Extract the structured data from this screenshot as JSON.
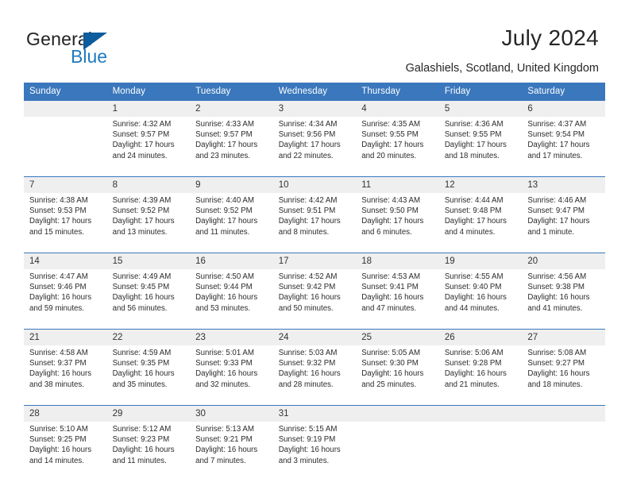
{
  "brand": {
    "word1": "General",
    "word2": "Blue",
    "triangle_color": "#0d5c9e",
    "blue_text_color": "#1f7ac0"
  },
  "header": {
    "title": "July 2024",
    "subtitle": "Galashiels, Scotland, United Kingdom",
    "header_bg_color": "#3a77bc",
    "daynum_bg_color": "#efefef"
  },
  "calendar": {
    "weekday_headers": [
      "Sunday",
      "Monday",
      "Tuesday",
      "Wednesday",
      "Thursday",
      "Friday",
      "Saturday"
    ],
    "weeks": [
      {
        "days": [
          {
            "date": "",
            "lines": []
          },
          {
            "date": "1",
            "lines": [
              "Sunrise: 4:32 AM",
              "Sunset: 9:57 PM",
              "Daylight: 17 hours",
              "and 24 minutes."
            ]
          },
          {
            "date": "2",
            "lines": [
              "Sunrise: 4:33 AM",
              "Sunset: 9:57 PM",
              "Daylight: 17 hours",
              "and 23 minutes."
            ]
          },
          {
            "date": "3",
            "lines": [
              "Sunrise: 4:34 AM",
              "Sunset: 9:56 PM",
              "Daylight: 17 hours",
              "and 22 minutes."
            ]
          },
          {
            "date": "4",
            "lines": [
              "Sunrise: 4:35 AM",
              "Sunset: 9:55 PM",
              "Daylight: 17 hours",
              "and 20 minutes."
            ]
          },
          {
            "date": "5",
            "lines": [
              "Sunrise: 4:36 AM",
              "Sunset: 9:55 PM",
              "Daylight: 17 hours",
              "and 18 minutes."
            ]
          },
          {
            "date": "6",
            "lines": [
              "Sunrise: 4:37 AM",
              "Sunset: 9:54 PM",
              "Daylight: 17 hours",
              "and 17 minutes."
            ]
          }
        ]
      },
      {
        "days": [
          {
            "date": "7",
            "lines": [
              "Sunrise: 4:38 AM",
              "Sunset: 9:53 PM",
              "Daylight: 17 hours",
              "and 15 minutes."
            ]
          },
          {
            "date": "8",
            "lines": [
              "Sunrise: 4:39 AM",
              "Sunset: 9:52 PM",
              "Daylight: 17 hours",
              "and 13 minutes."
            ]
          },
          {
            "date": "9",
            "lines": [
              "Sunrise: 4:40 AM",
              "Sunset: 9:52 PM",
              "Daylight: 17 hours",
              "and 11 minutes."
            ]
          },
          {
            "date": "10",
            "lines": [
              "Sunrise: 4:42 AM",
              "Sunset: 9:51 PM",
              "Daylight: 17 hours",
              "and 8 minutes."
            ]
          },
          {
            "date": "11",
            "lines": [
              "Sunrise: 4:43 AM",
              "Sunset: 9:50 PM",
              "Daylight: 17 hours",
              "and 6 minutes."
            ]
          },
          {
            "date": "12",
            "lines": [
              "Sunrise: 4:44 AM",
              "Sunset: 9:48 PM",
              "Daylight: 17 hours",
              "and 4 minutes."
            ]
          },
          {
            "date": "13",
            "lines": [
              "Sunrise: 4:46 AM",
              "Sunset: 9:47 PM",
              "Daylight: 17 hours",
              "and 1 minute."
            ]
          }
        ]
      },
      {
        "days": [
          {
            "date": "14",
            "lines": [
              "Sunrise: 4:47 AM",
              "Sunset: 9:46 PM",
              "Daylight: 16 hours",
              "and 59 minutes."
            ]
          },
          {
            "date": "15",
            "lines": [
              "Sunrise: 4:49 AM",
              "Sunset: 9:45 PM",
              "Daylight: 16 hours",
              "and 56 minutes."
            ]
          },
          {
            "date": "16",
            "lines": [
              "Sunrise: 4:50 AM",
              "Sunset: 9:44 PM",
              "Daylight: 16 hours",
              "and 53 minutes."
            ]
          },
          {
            "date": "17",
            "lines": [
              "Sunrise: 4:52 AM",
              "Sunset: 9:42 PM",
              "Daylight: 16 hours",
              "and 50 minutes."
            ]
          },
          {
            "date": "18",
            "lines": [
              "Sunrise: 4:53 AM",
              "Sunset: 9:41 PM",
              "Daylight: 16 hours",
              "and 47 minutes."
            ]
          },
          {
            "date": "19",
            "lines": [
              "Sunrise: 4:55 AM",
              "Sunset: 9:40 PM",
              "Daylight: 16 hours",
              "and 44 minutes."
            ]
          },
          {
            "date": "20",
            "lines": [
              "Sunrise: 4:56 AM",
              "Sunset: 9:38 PM",
              "Daylight: 16 hours",
              "and 41 minutes."
            ]
          }
        ]
      },
      {
        "days": [
          {
            "date": "21",
            "lines": [
              "Sunrise: 4:58 AM",
              "Sunset: 9:37 PM",
              "Daylight: 16 hours",
              "and 38 minutes."
            ]
          },
          {
            "date": "22",
            "lines": [
              "Sunrise: 4:59 AM",
              "Sunset: 9:35 PM",
              "Daylight: 16 hours",
              "and 35 minutes."
            ]
          },
          {
            "date": "23",
            "lines": [
              "Sunrise: 5:01 AM",
              "Sunset: 9:33 PM",
              "Daylight: 16 hours",
              "and 32 minutes."
            ]
          },
          {
            "date": "24",
            "lines": [
              "Sunrise: 5:03 AM",
              "Sunset: 9:32 PM",
              "Daylight: 16 hours",
              "and 28 minutes."
            ]
          },
          {
            "date": "25",
            "lines": [
              "Sunrise: 5:05 AM",
              "Sunset: 9:30 PM",
              "Daylight: 16 hours",
              "and 25 minutes."
            ]
          },
          {
            "date": "26",
            "lines": [
              "Sunrise: 5:06 AM",
              "Sunset: 9:28 PM",
              "Daylight: 16 hours",
              "and 21 minutes."
            ]
          },
          {
            "date": "27",
            "lines": [
              "Sunrise: 5:08 AM",
              "Sunset: 9:27 PM",
              "Daylight: 16 hours",
              "and 18 minutes."
            ]
          }
        ]
      },
      {
        "days": [
          {
            "date": "28",
            "lines": [
              "Sunrise: 5:10 AM",
              "Sunset: 9:25 PM",
              "Daylight: 16 hours",
              "and 14 minutes."
            ]
          },
          {
            "date": "29",
            "lines": [
              "Sunrise: 5:12 AM",
              "Sunset: 9:23 PM",
              "Daylight: 16 hours",
              "and 11 minutes."
            ]
          },
          {
            "date": "30",
            "lines": [
              "Sunrise: 5:13 AM",
              "Sunset: 9:21 PM",
              "Daylight: 16 hours",
              "and 7 minutes."
            ]
          },
          {
            "date": "31",
            "lines": [
              "Sunrise: 5:15 AM",
              "Sunset: 9:19 PM",
              "Daylight: 16 hours",
              "and 3 minutes."
            ]
          },
          {
            "date": "",
            "lines": []
          },
          {
            "date": "",
            "lines": []
          },
          {
            "date": "",
            "lines": []
          }
        ]
      }
    ]
  }
}
